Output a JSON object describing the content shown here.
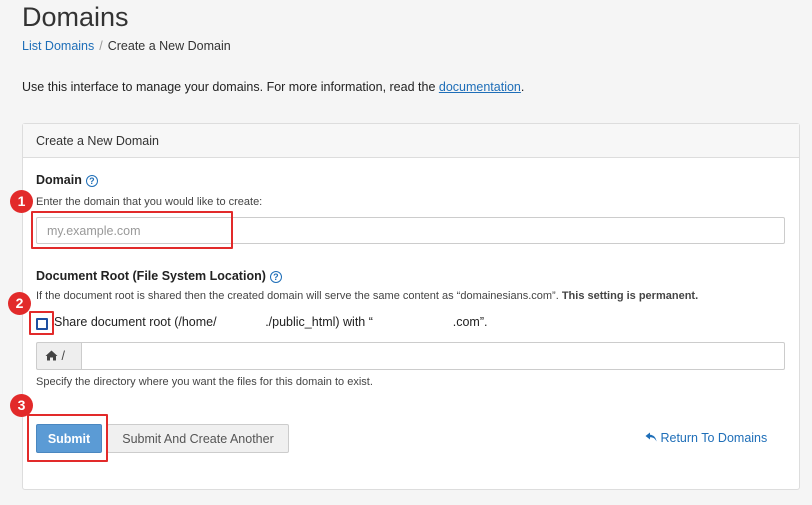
{
  "page": {
    "title": "Domains"
  },
  "breadcrumb": {
    "items": [
      "List Domains",
      "Create a New Domain"
    ],
    "separator": "/"
  },
  "intro": {
    "text": "Use this interface to manage your domains. For more information, read the ",
    "link": "documentation",
    "suffix": "."
  },
  "panel": {
    "heading": "Create a New Domain"
  },
  "domain_field": {
    "label": "Domain",
    "help_glyph": "?",
    "hint": "Enter the domain that you would like to create:",
    "placeholder": "my.example.com",
    "value": ""
  },
  "docroot_field": {
    "label": "Document Root (File System Location)",
    "help_glyph": "?",
    "info_text": "If the document root is shared then the created domain will serve the same content as “domainesians.com”. ",
    "info_bold": "This setting is permanent.",
    "checkbox_checked": false,
    "checkbox_label": "Share document root (/home/              ./public_html) with “                       .com”.",
    "prefix_icon": "home-icon",
    "prefix_text": "/",
    "value": "",
    "hint": "Specify the directory where you want the files for this domain to exist."
  },
  "actions": {
    "submit_label": "Submit",
    "submit_another_label": "Submit And Create Another",
    "return_label": "Return To Domains",
    "return_icon": "return-arrow-icon"
  },
  "annotations": {
    "steps": [
      "1",
      "2",
      "3"
    ],
    "color": "#e22a2a"
  },
  "colors": {
    "link": "#1e6eb8",
    "primary_button": "#5b9bd5",
    "highlight": "#e22a2a"
  }
}
